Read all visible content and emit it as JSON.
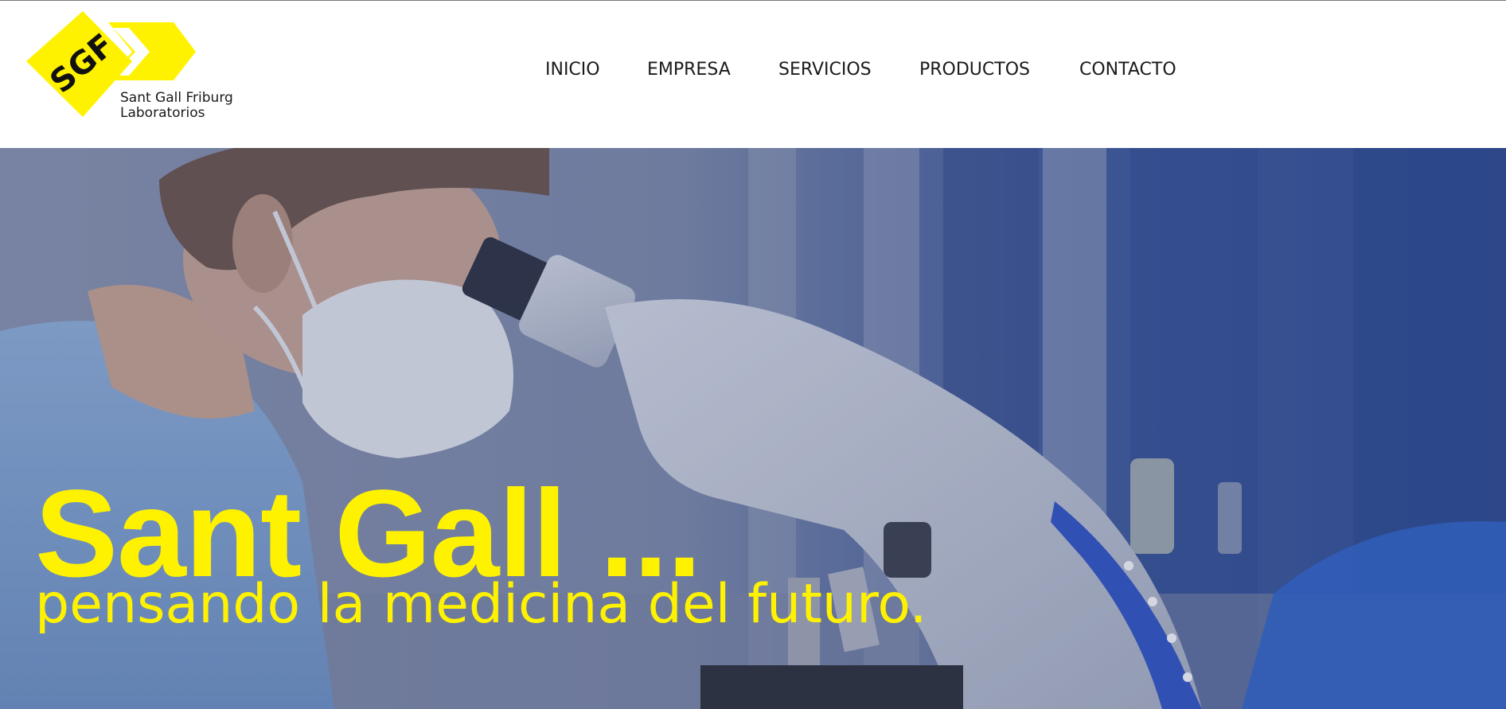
{
  "logo": {
    "monogram": "SGF",
    "line1": "Sant Gall Friburg",
    "line2": "Laboratorios",
    "color": "#fff200"
  },
  "nav": {
    "items": [
      {
        "label": "INICIO"
      },
      {
        "label": "EMPRESA"
      },
      {
        "label": "SERVICIOS"
      },
      {
        "label": "PRODUCTOS"
      },
      {
        "label": "CONTACTO"
      }
    ]
  },
  "hero": {
    "title": "Sant Gall ...",
    "subtitle": "pensando la medicina del futuro.",
    "text_color": "#fff200"
  }
}
